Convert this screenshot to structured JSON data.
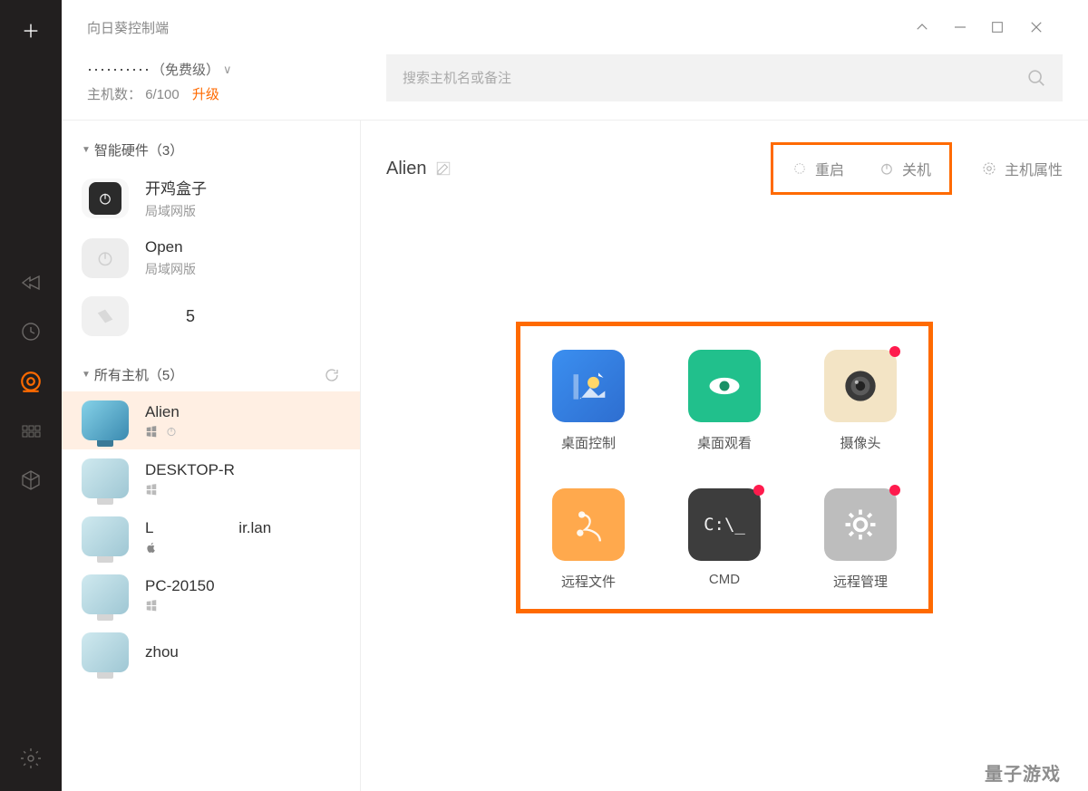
{
  "title": "向日葵控制端",
  "account": {
    "name": "· · · · · · · · · ·",
    "tier": "（免费级）",
    "chev": "∨",
    "hosts_label": "主机数：",
    "hosts_count": "6/100",
    "upgrade": "升级"
  },
  "search": {
    "placeholder": "搜索主机名或备注"
  },
  "groups": {
    "hardware": {
      "title": "智能硬件（3）"
    },
    "all": {
      "title": "所有主机（5）"
    }
  },
  "hw": [
    {
      "name": "开鸡盒子",
      "sub": "局域网版"
    },
    {
      "name": "Open",
      "sub": "局域网版"
    },
    {
      "name": "5",
      "sub": ""
    }
  ],
  "hosts": [
    {
      "name": "Alien"
    },
    {
      "name": "DESKTOP-R"
    },
    {
      "name": "L                    ir.lan"
    },
    {
      "name": "PC-20150"
    },
    {
      "name": "zhou"
    }
  ],
  "selected": {
    "name": "Alien"
  },
  "power": {
    "restart": "重启",
    "shutdown": "关机"
  },
  "hostprop": "主机属性",
  "actions": {
    "desktop_control": "桌面控制",
    "desktop_view": "桌面观看",
    "camera": "摄像头",
    "remote_file": "远程文件",
    "cmd": "CMD",
    "remote_manage": "远程管理",
    "cmd_text": "C:\\_"
  },
  "watermark": "量子游戏"
}
